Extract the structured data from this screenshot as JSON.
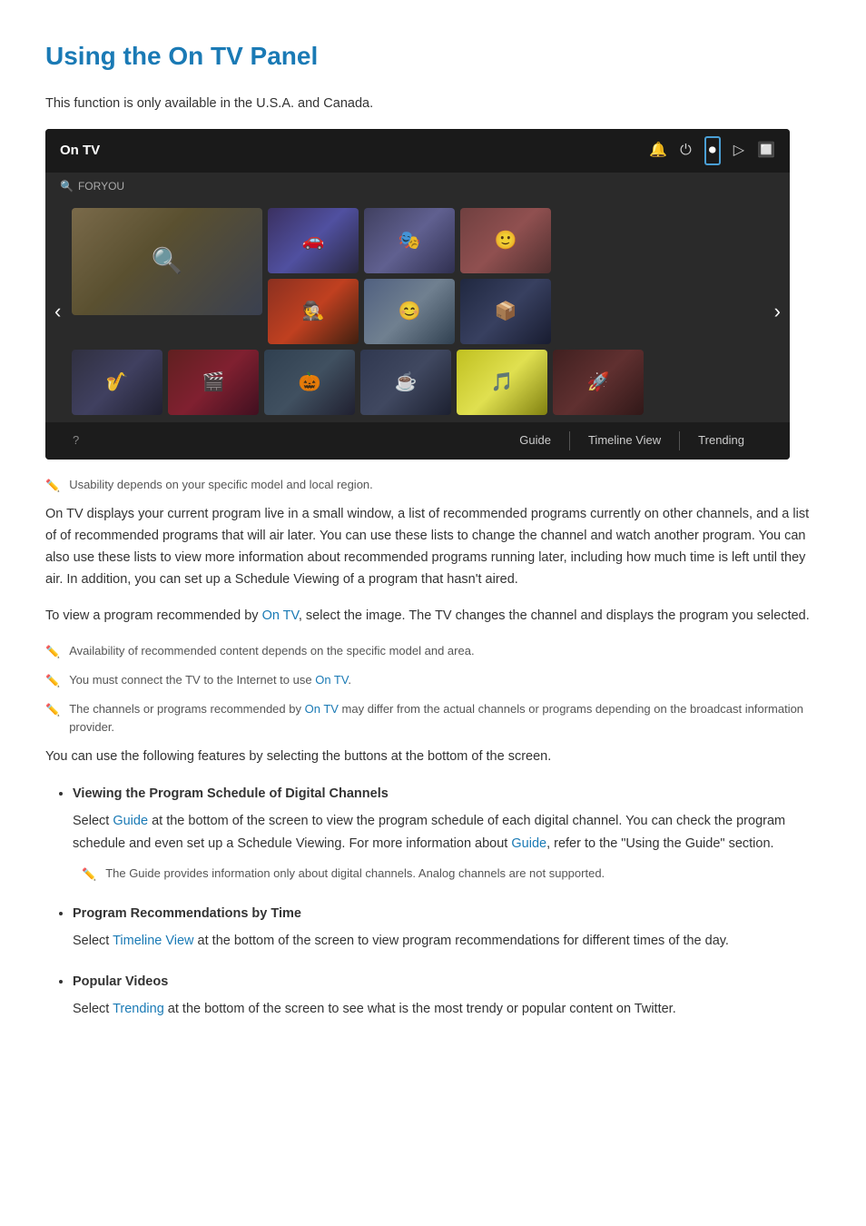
{
  "page": {
    "title": "Using the On TV Panel",
    "intro": "This function is only available in the U.S.A. and Canada.",
    "tv_panel": {
      "header_label": "On TV",
      "for_you_label": "FORYOU",
      "icons": [
        "🔔",
        "⏻",
        "⏺",
        "▷",
        "🔲"
      ],
      "footer_left": "?",
      "footer_links": [
        "Guide",
        "Timeline View",
        "Trending"
      ],
      "thumbnails_row1": [
        {
          "id": 1,
          "size": "large",
          "color_class": "thumb-1",
          "icon": "🔍"
        },
        {
          "id": 2,
          "size": "medium",
          "color_class": "thumb-2",
          "icon": "🚗"
        },
        {
          "id": 3,
          "size": "medium",
          "color_class": "thumb-3",
          "icon": "🕵"
        },
        {
          "id": 4,
          "size": "medium",
          "color_class": "thumb-4",
          "icon": "🙂"
        }
      ],
      "thumbnails_row2": [
        {
          "id": 5,
          "size": "medium",
          "color_class": "thumb-6",
          "icon": "🎵"
        },
        {
          "id": 6,
          "size": "medium",
          "color_class": "thumb-7",
          "icon": "🎭"
        },
        {
          "id": 7,
          "size": "medium",
          "color_class": "thumb-8",
          "icon": "📦"
        }
      ],
      "thumbnails_row3": [
        {
          "id": 8,
          "size": "small",
          "color_class": "thumb-9",
          "icon": "🎷"
        },
        {
          "id": 9,
          "size": "small",
          "color_class": "thumb-10",
          "icon": "🎬"
        },
        {
          "id": 10,
          "size": "small",
          "color_class": "thumb-11",
          "icon": "🎃"
        },
        {
          "id": 11,
          "size": "small",
          "color_class": "thumb-12",
          "icon": "☕"
        },
        {
          "id": 12,
          "size": "small",
          "color_class": "thumb-5",
          "icon": "🎵"
        },
        {
          "id": 13,
          "size": "small",
          "color_class": "thumb-13",
          "icon": "🚀"
        }
      ]
    },
    "note1": "Usability depends on your specific model and local region.",
    "body1": "On TV displays your current program live in a small window, a list of recommended programs currently on other channels, and a list of of recommended programs that will air later. You can use these lists to change the channel and watch another program. You can also use these lists to view more information about recommended programs running later, including how much time is left until they air. In addition, you can set up a Schedule Viewing of a program that hasn't aired.",
    "body2_prefix": "To view a program recommended by ",
    "body2_link": "On TV",
    "body2_suffix": ", select the image. The TV changes the channel and displays the program you selected.",
    "notes": [
      "Availability of recommended content depends on the specific model and area.",
      "You must connect the TV to the Internet to use ",
      "The channels or programs recommended by "
    ],
    "note2_link": "On TV",
    "note3_link": "On TV",
    "note3_suffix": " may differ from the actual channels or programs depending on the broadcast information provider.",
    "body3": "You can use the following features by selecting the buttons at the bottom of the screen.",
    "features": [
      {
        "title": "Viewing the Program Schedule of Digital Channels",
        "body_prefix": "Select ",
        "body_link": "Guide",
        "body_middle": " at the bottom of the screen to view the program schedule of each digital channel. You can check the program schedule and even set up a Schedule Viewing. For more information about ",
        "body_link2": "Guide",
        "body_suffix": ", refer to the \"Using the Guide\" section.",
        "sub_note": "The Guide provides information only about digital channels. Analog channels are not supported."
      },
      {
        "title": "Program Recommendations by Time",
        "body_prefix": "Select ",
        "body_link": "Timeline View",
        "body_suffix": " at the bottom of the screen to view program recommendations for different times of the day."
      },
      {
        "title": "Popular Videos",
        "body_prefix": "Select ",
        "body_link": "Trending",
        "body_suffix": " at the bottom of the screen to see what is the most trendy or popular content on Twitter."
      }
    ]
  }
}
